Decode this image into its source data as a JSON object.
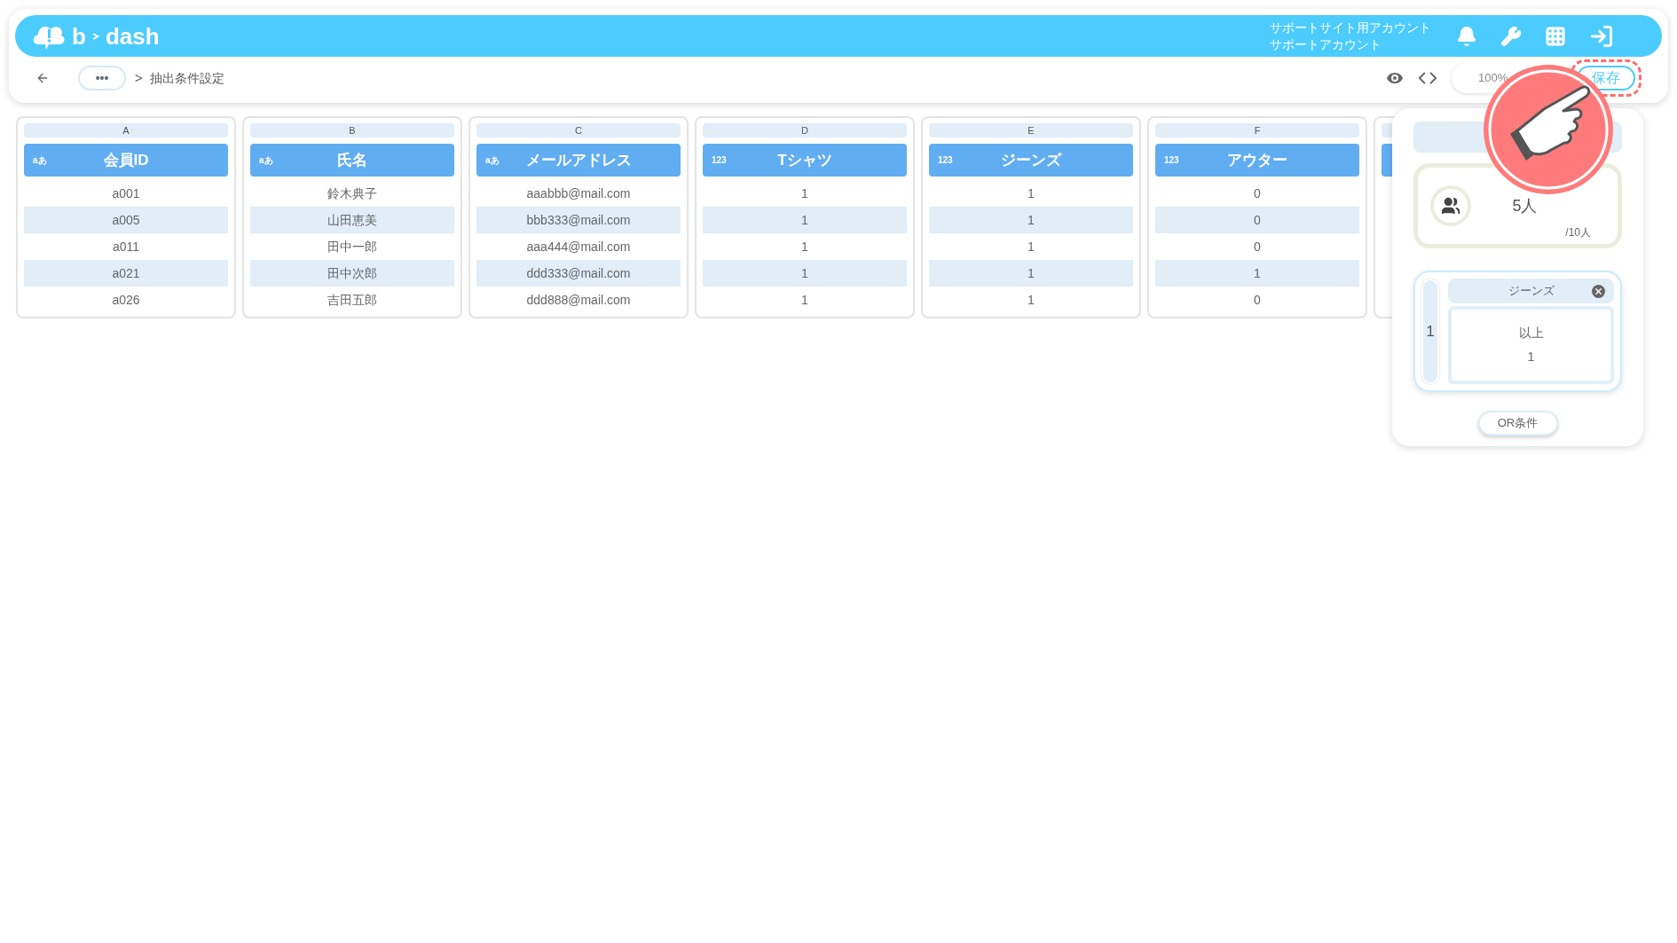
{
  "header": {
    "logo": [
      "b",
      "dash"
    ],
    "account_lines": [
      "サポートサイト用アカウント",
      "サポートアカウント"
    ]
  },
  "toolbar": {
    "more": "•••",
    "separator": ">",
    "breadcrumb": "抽出条件設定",
    "zoom": "100%",
    "save": {
      "label": "保存",
      "highlighted": true
    }
  },
  "table": {
    "columns": [
      {
        "letter": "A",
        "type_badge": "aあ",
        "title": "会員ID",
        "cells": [
          "a001",
          "a005",
          "a011",
          "a021",
          "a026"
        ]
      },
      {
        "letter": "B",
        "type_badge": "aあ",
        "title": "氏名",
        "cells": [
          "鈴木典子",
          "山田恵美",
          "田中一郎",
          "田中次郎",
          "吉田五郎"
        ]
      },
      {
        "letter": "C",
        "type_badge": "aあ",
        "title": "メールアドレス",
        "cells": [
          "aaabbb@mail.com",
          "bbb333@mail.com",
          "aaa444@mail.com",
          "ddd333@mail.com",
          "ddd888@mail.com"
        ]
      },
      {
        "letter": "D",
        "type_badge": "123",
        "title": "Tシャツ",
        "cells": [
          "1",
          "1",
          "1",
          "1",
          "1"
        ]
      },
      {
        "letter": "E",
        "type_badge": "123",
        "title": "ジーンズ",
        "cells": [
          "1",
          "1",
          "1",
          "1",
          "1"
        ]
      },
      {
        "letter": "F",
        "type_badge": "123",
        "title": "アウター",
        "cells": [
          "0",
          "0",
          "0",
          "1",
          "0"
        ]
      }
    ]
  },
  "panel": {
    "count": "5人",
    "total": "/10人",
    "conditions": [
      {
        "group": "1",
        "field": "ジーンズ",
        "operator": "以上",
        "value": "1"
      }
    ],
    "or_button": "OR条件"
  }
}
